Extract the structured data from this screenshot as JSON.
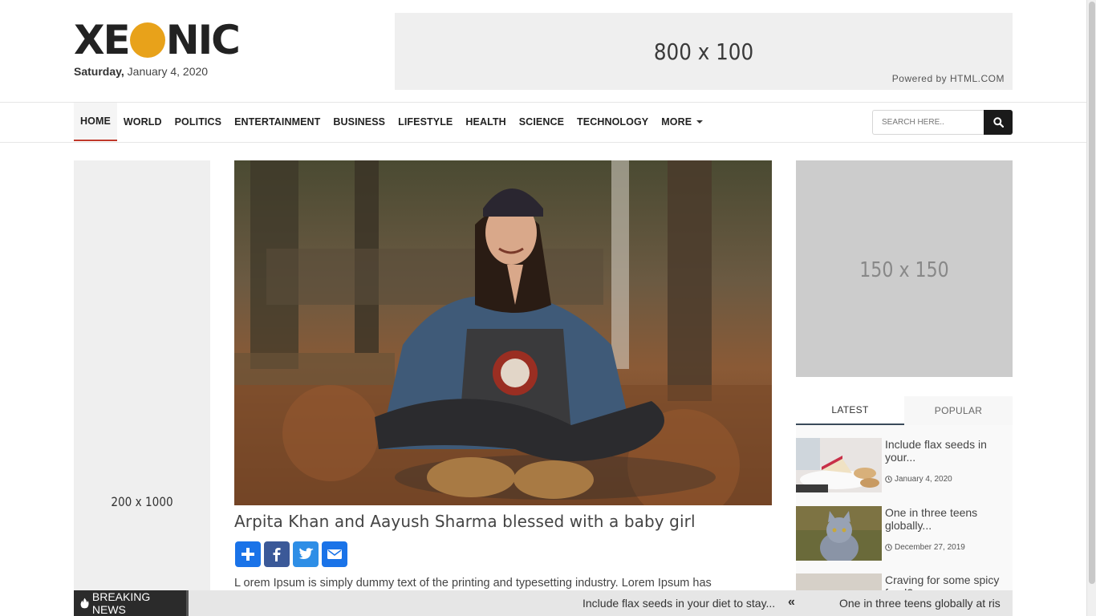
{
  "header": {
    "logo_part1": "XE",
    "logo_part2": "NIC",
    "date_day": "Saturday,",
    "date_rest": " January 4, 2020",
    "ad_banner_text": "800 x 100",
    "ad_powered_by": "Powered by HTML.COM"
  },
  "nav": {
    "items": [
      {
        "label": "HOME",
        "active": true
      },
      {
        "label": "WORLD"
      },
      {
        "label": "POLITICS"
      },
      {
        "label": "ENTERTAINMENT"
      },
      {
        "label": "BUSINESS"
      },
      {
        "label": "LIFESTYLE"
      },
      {
        "label": "HEALTH"
      },
      {
        "label": "SCIENCE"
      },
      {
        "label": "TECHNOLOGY"
      },
      {
        "label": "MORE",
        "dropdown": true
      }
    ],
    "search_placeholder": "SEARCH HERE.."
  },
  "left_ad": {
    "text": "200 x 1000"
  },
  "article": {
    "title": "Arpita Khan and Aayush Sharma blessed with a baby girl",
    "share": [
      {
        "icon": "addthis-plus-icon",
        "color": "#1a73e8"
      },
      {
        "icon": "facebook-icon",
        "color": "#3b5998"
      },
      {
        "icon": "twitter-icon",
        "color": "#2e8ee6"
      },
      {
        "icon": "email-icon",
        "color": "#1a73e8"
      }
    ],
    "excerpt": "L orem Ipsum is simply dummy text of the printing and typesetting industry. Lorem Ipsum has"
  },
  "right_ad": {
    "text": "150 x 150"
  },
  "sidebar": {
    "tabs": [
      {
        "label": "LATEST",
        "active": true
      },
      {
        "label": "POPULAR"
      }
    ],
    "posts": [
      {
        "title": "Include flax seeds in your...",
        "date": "January 4, 2020"
      },
      {
        "title": "One in three teens globally...",
        "date": "December 27, 2019"
      },
      {
        "title": "Craving for some spicy food?",
        "date": ""
      }
    ]
  },
  "breaking": {
    "label": "BREAKING NEWS",
    "items": [
      "Include flax seeds in your diet to stay...",
      "One in three teens globally at ris"
    ]
  },
  "colors": {
    "accent_red": "#c0392b",
    "logo_orange": "#e8a21a",
    "dark": "#1a1a1a"
  }
}
